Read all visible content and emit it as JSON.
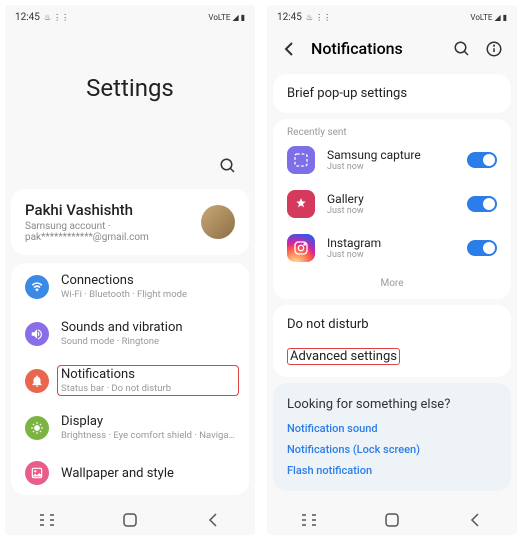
{
  "status": {
    "time": "12:45",
    "carrier_icons": "⚡ ⋮⋮⋮",
    "right_icons": "Vo LTE ▼▲ 📶"
  },
  "left": {
    "title": "Settings",
    "account": {
      "name": "Pakhi Vashishth",
      "sub": "Samsung account · pak************@gmail.com"
    },
    "items": [
      {
        "title": "Connections",
        "sub": "Wi-Fi · Bluetooth · Flight mode",
        "color": "#3b8ae6",
        "icon": "wifi"
      },
      {
        "title": "Sounds and vibration",
        "sub": "Sound mode · Ringtone",
        "color": "#8a6de8",
        "icon": "sound"
      },
      {
        "title": "Notifications",
        "sub": "Status bar · Do not disturb",
        "color": "#e8674e",
        "icon": "bell",
        "highlight": true
      },
      {
        "title": "Display",
        "sub": "Brightness · Eye comfort shield · Navigation bar",
        "color": "#7cb342",
        "icon": "display"
      },
      {
        "title": "Wallpaper and style",
        "sub": "",
        "color": "#e85d8a",
        "icon": "wallpaper"
      }
    ]
  },
  "right": {
    "header": "Notifications",
    "brief": "Brief pop-up settings",
    "recent_label": "Recently sent",
    "apps": [
      {
        "name": "Samsung capture",
        "sub": "Just now",
        "color": "#7c6fe8"
      },
      {
        "name": "Gallery",
        "sub": "Just now",
        "color": "#d43a5c"
      },
      {
        "name": "Instagram",
        "sub": "Just now",
        "color": "instagram"
      }
    ],
    "more": "More",
    "dnd": "Do not disturb",
    "advanced": "Advanced settings",
    "looking": {
      "title": "Looking for something else?",
      "links": [
        "Notification sound",
        "Notifications (Lock screen)",
        "Flash notification"
      ]
    }
  }
}
